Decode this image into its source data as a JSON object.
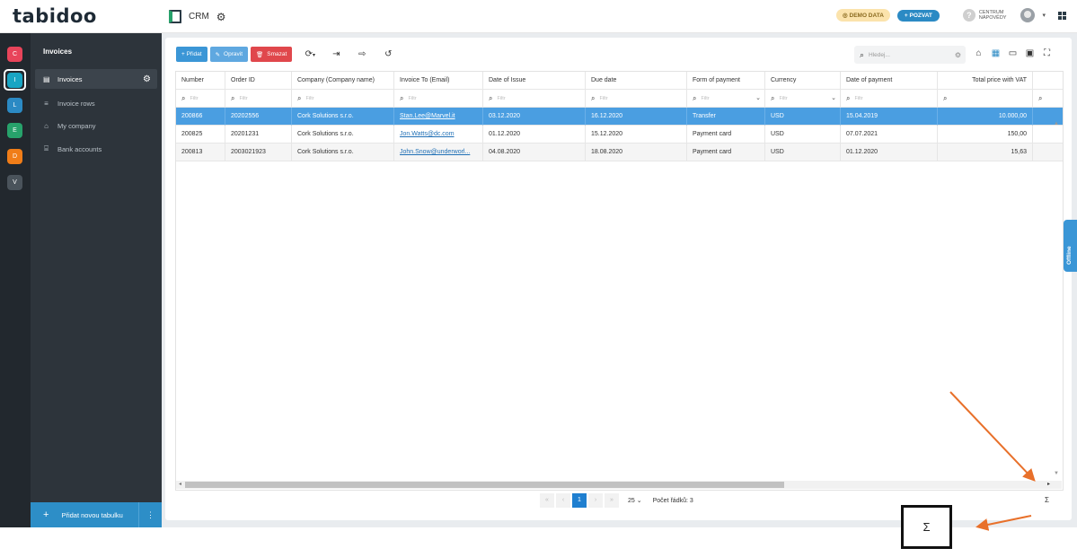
{
  "app": {
    "logo": "tabidoo",
    "crumb_title": "CRM",
    "demo_label": "DEMO DATA",
    "invite_label": "+ POZVAT",
    "help_line1": "CENTRUM",
    "help_line2": "NÁPOVĚDY"
  },
  "rail": {
    "items": [
      {
        "letter": "C",
        "color": "#e8445a"
      },
      {
        "letter": "I",
        "color": "#18a5c4"
      },
      {
        "letter": "L",
        "color": "#2b8ac4"
      },
      {
        "letter": "E",
        "color": "#27a26b"
      },
      {
        "letter": "D",
        "color": "#f07d18"
      },
      {
        "letter": "V",
        "color": "#4a535b"
      }
    ]
  },
  "sidebar": {
    "title": "Invoices",
    "items": [
      {
        "label": "Invoices",
        "icon": "file-icon"
      },
      {
        "label": "Invoice rows",
        "icon": "list-icon"
      },
      {
        "label": "My company",
        "icon": "home-icon"
      },
      {
        "label": "Bank accounts",
        "icon": "bank-icon"
      }
    ],
    "add_label": "Přidat novou tabulku"
  },
  "toolbar": {
    "add_label": "+ Přidat",
    "edit_label": "Opravit",
    "delete_label": "Smazat",
    "add_color": "#3b96d6",
    "edit_color": "#5fa8e0",
    "delete_color": "#e0474c",
    "search_placeholder": "Hledej..."
  },
  "grid": {
    "columns": [
      "Number",
      "Order ID",
      "Company (Company name)",
      "Invoice To (Email)",
      "Date of Issue",
      "Due date",
      "Form of payment",
      "Currency",
      "Date of payment",
      "Total price with VAT"
    ],
    "filter_placeholder": "Filtr",
    "rows": [
      [
        "200866",
        "20202556",
        "Cork Solutions s.r.o.",
        "Stan.Lee@Marvel.it",
        "03.12.2020",
        "16.12.2020",
        "Transfer",
        "USD",
        "15.04.2019",
        "10.000,00"
      ],
      [
        "200825",
        "20201231",
        "Cork Solutions s.r.o.",
        "Jon.Watts@dc.com",
        "01.12.2020",
        "15.12.2020",
        "Payment card",
        "USD",
        "07.07.2021",
        "150,00"
      ],
      [
        "200813",
        "2003021923",
        "Cork Solutions s.r.o.",
        "John.Snow@underworl...",
        "04.08.2020",
        "18.08.2020",
        "Payment card",
        "USD",
        "01.12.2020",
        "15,63"
      ]
    ]
  },
  "pager": {
    "current_page": "1",
    "page_size": "25",
    "row_count_label": "Počet řádků: 3",
    "sigma": "Σ"
  },
  "offline_label": "Offline",
  "annotation": {
    "sigma": "Σ",
    "arrow_color": "#e8702a"
  }
}
